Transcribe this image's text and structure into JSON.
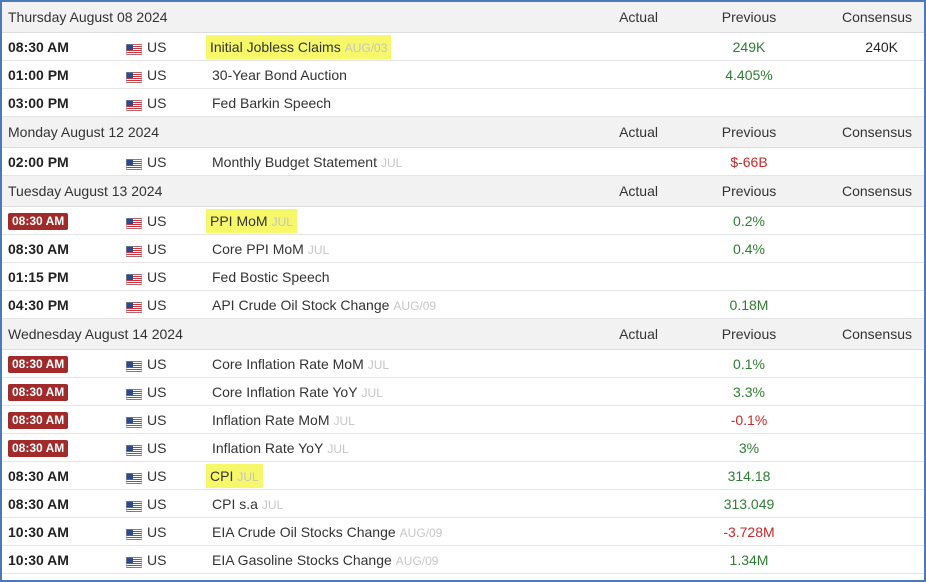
{
  "colors": {
    "accent_border": "#4a7ab8",
    "highlight": "#f7f76a",
    "badge": "#a12a2a",
    "positive": "#2e7d32",
    "negative": "#c62828"
  },
  "columns": {
    "actual": "Actual",
    "previous": "Previous",
    "consensus": "Consensus"
  },
  "days": [
    {
      "date": "Thursday August 08 2024",
      "events": [
        {
          "time": "08:30 AM",
          "badge": false,
          "country": "US",
          "event": "Initial Jobless Claims",
          "ref": "AUG/03",
          "highlight": true,
          "actual": "",
          "previous": "249K",
          "previous_tone": "pos",
          "consensus": "240K"
        },
        {
          "time": "01:00 PM",
          "badge": false,
          "country": "US",
          "event": "30-Year Bond Auction",
          "ref": "",
          "highlight": false,
          "actual": "",
          "previous": "4.405%",
          "previous_tone": "pos",
          "consensus": ""
        },
        {
          "time": "03:00 PM",
          "badge": false,
          "country": "US",
          "event": "Fed Barkin Speech",
          "ref": "",
          "highlight": false,
          "actual": "",
          "previous": "",
          "previous_tone": "",
          "consensus": ""
        }
      ]
    },
    {
      "date": "Monday August 12 2024",
      "events": [
        {
          "time": "02:00 PM",
          "badge": false,
          "country": "US",
          "event": "Monthly Budget Statement",
          "ref": "JUL",
          "highlight": false,
          "actual": "",
          "previous": "$-66B",
          "previous_tone": "neg",
          "consensus": ""
        }
      ]
    },
    {
      "date": "Tuesday August 13 2024",
      "events": [
        {
          "time": "08:30 AM",
          "badge": true,
          "country": "US",
          "event": "PPI MoM",
          "ref": "JUL",
          "highlight": true,
          "actual": "",
          "previous": "0.2%",
          "previous_tone": "pos",
          "consensus": ""
        },
        {
          "time": "08:30 AM",
          "badge": false,
          "country": "US",
          "event": "Core PPI MoM",
          "ref": "JUL",
          "highlight": false,
          "actual": "",
          "previous": "0.4%",
          "previous_tone": "pos",
          "consensus": ""
        },
        {
          "time": "01:15 PM",
          "badge": false,
          "country": "US",
          "event": "Fed Bostic Speech",
          "ref": "",
          "highlight": false,
          "actual": "",
          "previous": "",
          "previous_tone": "",
          "consensus": ""
        },
        {
          "time": "04:30 PM",
          "badge": false,
          "country": "US",
          "event": "API Crude Oil Stock Change",
          "ref": "AUG/09",
          "highlight": false,
          "actual": "",
          "previous": "0.18M",
          "previous_tone": "pos",
          "consensus": ""
        }
      ]
    },
    {
      "date": "Wednesday August 14 2024",
      "events": [
        {
          "time": "08:30 AM",
          "badge": true,
          "country": "US",
          "event": "Core Inflation Rate MoM",
          "ref": "JUL",
          "highlight": false,
          "actual": "",
          "previous": "0.1%",
          "previous_tone": "pos",
          "consensus": ""
        },
        {
          "time": "08:30 AM",
          "badge": true,
          "country": "US",
          "event": "Core Inflation Rate YoY",
          "ref": "JUL",
          "highlight": false,
          "actual": "",
          "previous": "3.3%",
          "previous_tone": "pos",
          "consensus": ""
        },
        {
          "time": "08:30 AM",
          "badge": true,
          "country": "US",
          "event": "Inflation Rate MoM",
          "ref": "JUL",
          "highlight": false,
          "actual": "",
          "previous": "-0.1%",
          "previous_tone": "neg",
          "consensus": ""
        },
        {
          "time": "08:30 AM",
          "badge": true,
          "country": "US",
          "event": "Inflation Rate YoY",
          "ref": "JUL",
          "highlight": false,
          "actual": "",
          "previous": "3%",
          "previous_tone": "pos",
          "consensus": ""
        },
        {
          "time": "08:30 AM",
          "badge": false,
          "country": "US",
          "event": "CPI",
          "ref": "JUL",
          "highlight": true,
          "actual": "",
          "previous": "314.18",
          "previous_tone": "pos",
          "consensus": ""
        },
        {
          "time": "08:30 AM",
          "badge": false,
          "country": "US",
          "event": "CPI s.a",
          "ref": "JUL",
          "highlight": false,
          "actual": "",
          "previous": "313.049",
          "previous_tone": "pos",
          "consensus": ""
        },
        {
          "time": "10:30 AM",
          "badge": false,
          "country": "US",
          "event": "EIA Crude Oil Stocks Change",
          "ref": "AUG/09",
          "highlight": false,
          "actual": "",
          "previous": "-3.728M",
          "previous_tone": "neg",
          "consensus": ""
        },
        {
          "time": "10:30 AM",
          "badge": false,
          "country": "US",
          "event": "EIA Gasoline Stocks Change",
          "ref": "AUG/09",
          "highlight": false,
          "actual": "",
          "previous": "1.34M",
          "previous_tone": "pos",
          "consensus": ""
        }
      ]
    }
  ]
}
